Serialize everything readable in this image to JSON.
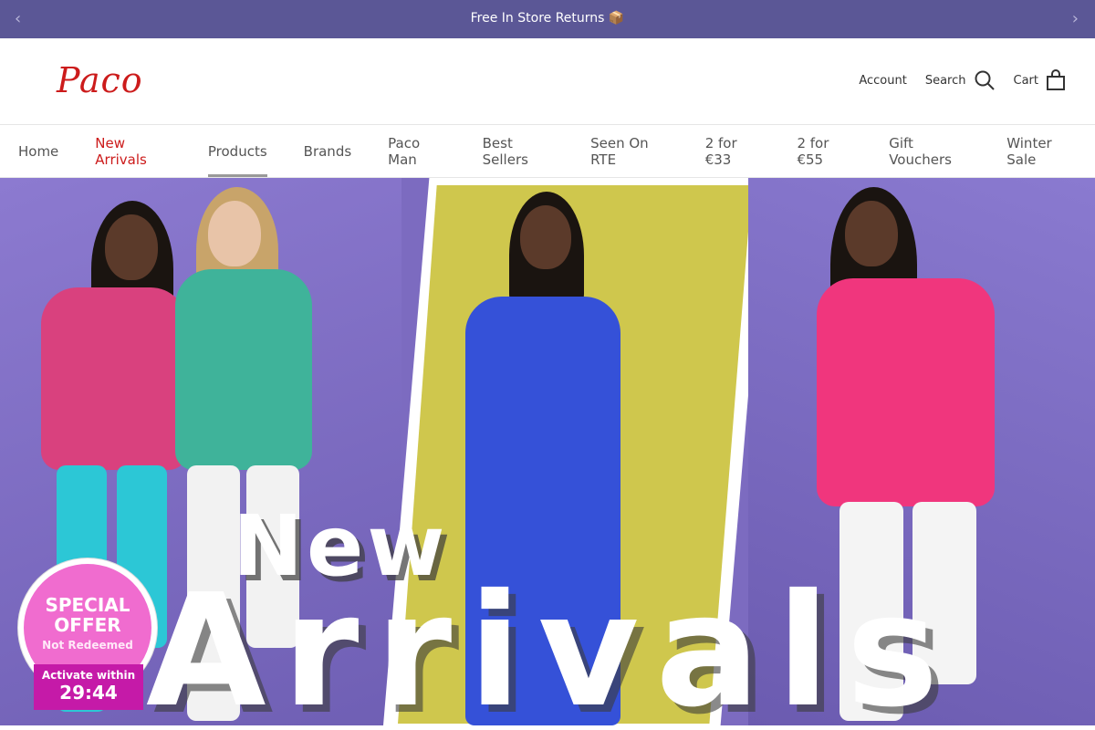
{
  "announcement": {
    "message": "Free In Store Returns 📦",
    "prev_arrow": "‹",
    "next_arrow": "›"
  },
  "header": {
    "logo": "Paco",
    "account_label": "Account",
    "search_label": "Search",
    "cart_label": "Cart"
  },
  "nav": {
    "items": [
      {
        "label": "Home"
      },
      {
        "label": "New Arrivals"
      },
      {
        "label": "Products"
      },
      {
        "label": "Brands"
      },
      {
        "label": "Paco Man"
      },
      {
        "label": "Best Sellers"
      },
      {
        "label": "Seen On RTE"
      },
      {
        "label": "2 for €33"
      },
      {
        "label": "2 for €55"
      },
      {
        "label": "Gift Vouchers"
      },
      {
        "label": "Winter Sale"
      }
    ]
  },
  "hero": {
    "headline_top": "New",
    "headline_bottom": "Arrivals"
  },
  "offer": {
    "title": "SPECIAL OFFER",
    "status": "Not Redeemed",
    "activate_label": "Activate within",
    "countdown": "29:44"
  },
  "colors": {
    "announcement_bg": "#5b5796",
    "brand_red": "#cc1b1b",
    "offer_pink": "#f06ccf",
    "timer_magenta": "#c51aa8"
  }
}
